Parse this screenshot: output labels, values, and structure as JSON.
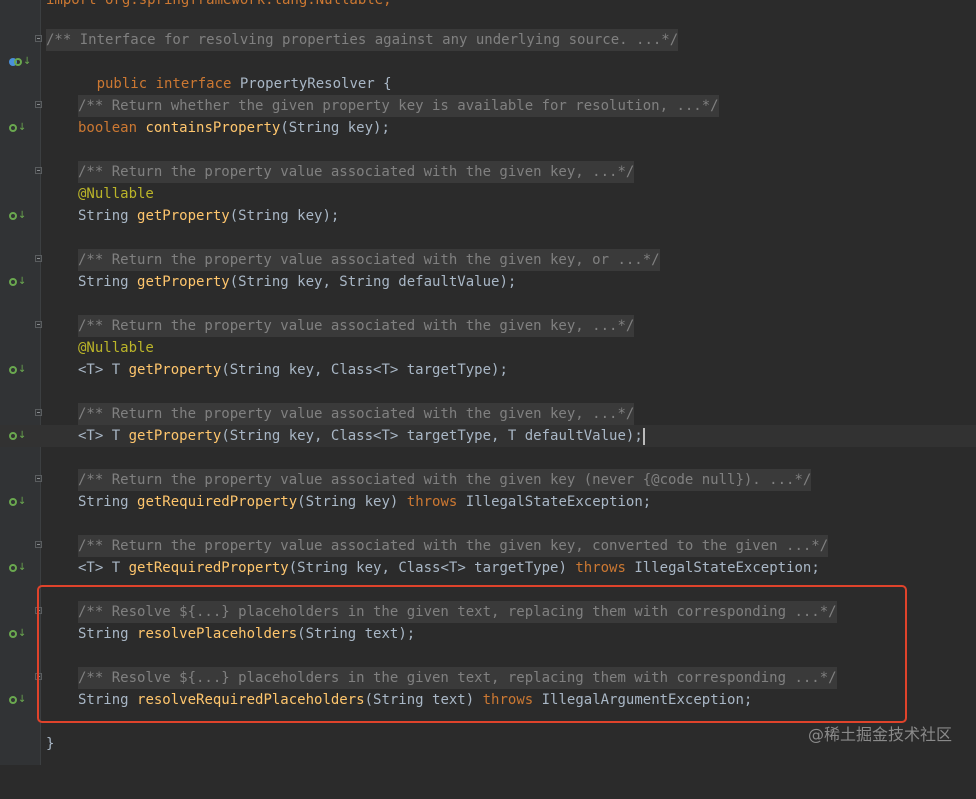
{
  "editor": {
    "top_partial": "import org.springframework.lang.Nullable;",
    "interface_doc": "/** Interface for resolving properties against any underlying source. ...*/",
    "interface_decl": {
      "modifier": "public interface",
      "name": "PropertyResolver",
      "brace": "{"
    },
    "methods": [
      {
        "doc": "/** Return whether the given property key is available for resolution, ...*/",
        "annotation": null,
        "return": "boolean",
        "name": "containsProperty",
        "params": "(String key);"
      },
      {
        "doc": "/** Return the property value associated with the given key, ...*/",
        "annotation": "@Nullable",
        "return": "String",
        "name": "getProperty",
        "params": "(String key);"
      },
      {
        "doc": "/** Return the property value associated with the given key, or ...*/",
        "annotation": null,
        "return": "String",
        "name": "getProperty",
        "params": "(String key, String defaultValue);"
      },
      {
        "doc": "/** Return the property value associated with the given key, ...*/",
        "annotation": "@Nullable",
        "return": "<T> T",
        "name": "getProperty",
        "params": "(String key, Class<T> targetType);"
      },
      {
        "doc": "/** Return the property value associated with the given key, ...*/",
        "annotation": null,
        "return": "<T> T",
        "name": "getProperty",
        "params": "(String key, Class<T> targetType, T defaultValue);"
      },
      {
        "doc": "/** Return the property value associated with the given key (never {@code null}). ...*/",
        "annotation": null,
        "return": "String",
        "name": "getRequiredProperty",
        "params": "(String key)",
        "throws_kw": "throws",
        "throws_type": "IllegalStateException;"
      },
      {
        "doc": "/** Return the property value associated with the given key, converted to the given ...*/",
        "annotation": null,
        "return": "<T> T",
        "name": "getRequiredProperty",
        "params": "(String key, Class<T> targetType)",
        "throws_kw": "throws",
        "throws_type": "IllegalStateException;"
      },
      {
        "doc": "/** Resolve ${...} placeholders in the given text, replacing them with corresponding ...*/",
        "annotation": null,
        "return": "String",
        "name": "resolvePlaceholders",
        "params": "(String text);"
      },
      {
        "doc": "/** Resolve ${...} placeholders in the given text, replacing them with corresponding ...*/",
        "annotation": null,
        "return": "String",
        "name": "resolveRequiredPlaceholders",
        "params": "(String text)",
        "throws_kw": "throws",
        "throws_type": "IllegalArgumentException;"
      }
    ],
    "closing_brace": "}"
  },
  "watermark": "@稀土掘金技术社区",
  "colors": {
    "background": "#2b2b2b",
    "keyword": "#cc7832",
    "method": "#ffc66d",
    "annotation": "#bbb529",
    "comment": "#808080",
    "text": "#a9b7c6",
    "highlight_box": "#e0432b"
  }
}
